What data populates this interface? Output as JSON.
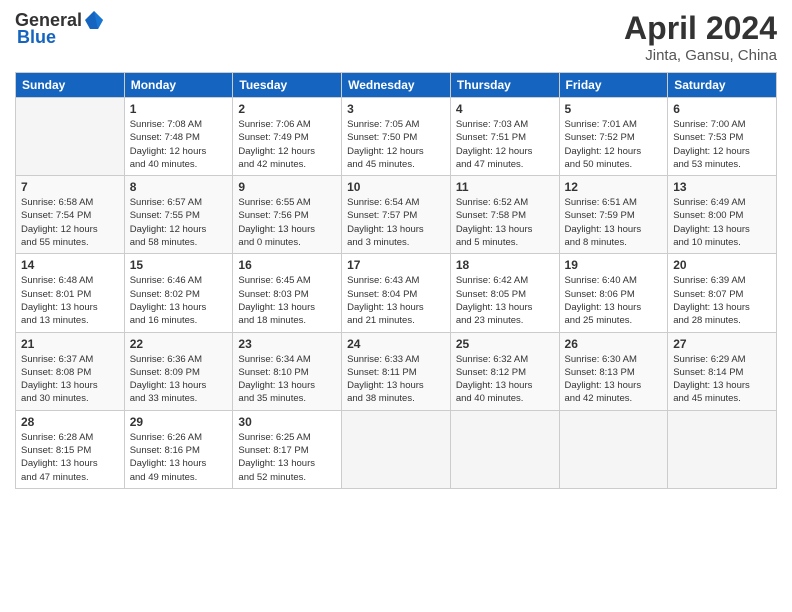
{
  "header": {
    "logo_general": "General",
    "logo_blue": "Blue",
    "month_title": "April 2024",
    "location": "Jinta, Gansu, China"
  },
  "weekdays": [
    "Sunday",
    "Monday",
    "Tuesday",
    "Wednesday",
    "Thursday",
    "Friday",
    "Saturday"
  ],
  "weeks": [
    [
      {
        "day": "",
        "info": ""
      },
      {
        "day": "1",
        "info": "Sunrise: 7:08 AM\nSunset: 7:48 PM\nDaylight: 12 hours\nand 40 minutes."
      },
      {
        "day": "2",
        "info": "Sunrise: 7:06 AM\nSunset: 7:49 PM\nDaylight: 12 hours\nand 42 minutes."
      },
      {
        "day": "3",
        "info": "Sunrise: 7:05 AM\nSunset: 7:50 PM\nDaylight: 12 hours\nand 45 minutes."
      },
      {
        "day": "4",
        "info": "Sunrise: 7:03 AM\nSunset: 7:51 PM\nDaylight: 12 hours\nand 47 minutes."
      },
      {
        "day": "5",
        "info": "Sunrise: 7:01 AM\nSunset: 7:52 PM\nDaylight: 12 hours\nand 50 minutes."
      },
      {
        "day": "6",
        "info": "Sunrise: 7:00 AM\nSunset: 7:53 PM\nDaylight: 12 hours\nand 53 minutes."
      }
    ],
    [
      {
        "day": "7",
        "info": "Sunrise: 6:58 AM\nSunset: 7:54 PM\nDaylight: 12 hours\nand 55 minutes."
      },
      {
        "day": "8",
        "info": "Sunrise: 6:57 AM\nSunset: 7:55 PM\nDaylight: 12 hours\nand 58 minutes."
      },
      {
        "day": "9",
        "info": "Sunrise: 6:55 AM\nSunset: 7:56 PM\nDaylight: 13 hours\nand 0 minutes."
      },
      {
        "day": "10",
        "info": "Sunrise: 6:54 AM\nSunset: 7:57 PM\nDaylight: 13 hours\nand 3 minutes."
      },
      {
        "day": "11",
        "info": "Sunrise: 6:52 AM\nSunset: 7:58 PM\nDaylight: 13 hours\nand 5 minutes."
      },
      {
        "day": "12",
        "info": "Sunrise: 6:51 AM\nSunset: 7:59 PM\nDaylight: 13 hours\nand 8 minutes."
      },
      {
        "day": "13",
        "info": "Sunrise: 6:49 AM\nSunset: 8:00 PM\nDaylight: 13 hours\nand 10 minutes."
      }
    ],
    [
      {
        "day": "14",
        "info": "Sunrise: 6:48 AM\nSunset: 8:01 PM\nDaylight: 13 hours\nand 13 minutes."
      },
      {
        "day": "15",
        "info": "Sunrise: 6:46 AM\nSunset: 8:02 PM\nDaylight: 13 hours\nand 16 minutes."
      },
      {
        "day": "16",
        "info": "Sunrise: 6:45 AM\nSunset: 8:03 PM\nDaylight: 13 hours\nand 18 minutes."
      },
      {
        "day": "17",
        "info": "Sunrise: 6:43 AM\nSunset: 8:04 PM\nDaylight: 13 hours\nand 21 minutes."
      },
      {
        "day": "18",
        "info": "Sunrise: 6:42 AM\nSunset: 8:05 PM\nDaylight: 13 hours\nand 23 minutes."
      },
      {
        "day": "19",
        "info": "Sunrise: 6:40 AM\nSunset: 8:06 PM\nDaylight: 13 hours\nand 25 minutes."
      },
      {
        "day": "20",
        "info": "Sunrise: 6:39 AM\nSunset: 8:07 PM\nDaylight: 13 hours\nand 28 minutes."
      }
    ],
    [
      {
        "day": "21",
        "info": "Sunrise: 6:37 AM\nSunset: 8:08 PM\nDaylight: 13 hours\nand 30 minutes."
      },
      {
        "day": "22",
        "info": "Sunrise: 6:36 AM\nSunset: 8:09 PM\nDaylight: 13 hours\nand 33 minutes."
      },
      {
        "day": "23",
        "info": "Sunrise: 6:34 AM\nSunset: 8:10 PM\nDaylight: 13 hours\nand 35 minutes."
      },
      {
        "day": "24",
        "info": "Sunrise: 6:33 AM\nSunset: 8:11 PM\nDaylight: 13 hours\nand 38 minutes."
      },
      {
        "day": "25",
        "info": "Sunrise: 6:32 AM\nSunset: 8:12 PM\nDaylight: 13 hours\nand 40 minutes."
      },
      {
        "day": "26",
        "info": "Sunrise: 6:30 AM\nSunset: 8:13 PM\nDaylight: 13 hours\nand 42 minutes."
      },
      {
        "day": "27",
        "info": "Sunrise: 6:29 AM\nSunset: 8:14 PM\nDaylight: 13 hours\nand 45 minutes."
      }
    ],
    [
      {
        "day": "28",
        "info": "Sunrise: 6:28 AM\nSunset: 8:15 PM\nDaylight: 13 hours\nand 47 minutes."
      },
      {
        "day": "29",
        "info": "Sunrise: 6:26 AM\nSunset: 8:16 PM\nDaylight: 13 hours\nand 49 minutes."
      },
      {
        "day": "30",
        "info": "Sunrise: 6:25 AM\nSunset: 8:17 PM\nDaylight: 13 hours\nand 52 minutes."
      },
      {
        "day": "",
        "info": ""
      },
      {
        "day": "",
        "info": ""
      },
      {
        "day": "",
        "info": ""
      },
      {
        "day": "",
        "info": ""
      }
    ]
  ]
}
